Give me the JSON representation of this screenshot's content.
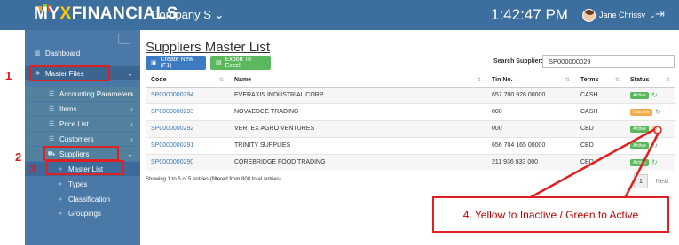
{
  "topbar": {
    "logo_prefix": "MY",
    "logo_x": "X",
    "logo_suffix": "FINANCIALS",
    "company": "Company S",
    "clock": "1:42:47 PM",
    "user": "Jane Chrissy"
  },
  "sidebar": {
    "items": [
      {
        "label": "Dashboard",
        "icon": "chart-icon"
      },
      {
        "label": "Master Files",
        "icon": "gear-icon"
      },
      {
        "label": "Accounting Parameters",
        "icon": "list-icon"
      },
      {
        "label": "Items",
        "icon": "list-icon"
      },
      {
        "label": "Price List",
        "icon": "list-icon"
      },
      {
        "label": "Customers",
        "icon": "list-icon"
      },
      {
        "label": "Suppliers",
        "icon": "truck-icon"
      },
      {
        "label": "Master List",
        "icon": "double-chevron-icon"
      },
      {
        "label": "Types",
        "icon": "double-chevron-icon"
      },
      {
        "label": "Classification",
        "icon": "double-chevron-icon"
      },
      {
        "label": "Groupings",
        "icon": "double-chevron-icon"
      }
    ]
  },
  "page": {
    "title": "Suppliers Master List",
    "create_button": "Create New (F1)",
    "export_button": "Export To Excel",
    "search_label": "Search Supplier:",
    "search_value": "SP000000029"
  },
  "table": {
    "headers": [
      "Code",
      "Name",
      "Tin No.",
      "Terms",
      "Status"
    ],
    "rows": [
      {
        "code": "SP0000000294",
        "name": "EVERAXIS INDUSTRIAL CORP.",
        "tin": "657 700 928 00000",
        "terms": "CASH",
        "status": "Active"
      },
      {
        "code": "SP0000000293",
        "name": "NOVAEDGE TRADING",
        "tin": "000",
        "terms": "CASH",
        "status": "Inactive"
      },
      {
        "code": "SP0000000292",
        "name": "VERTEX AGRO VENTURES",
        "tin": "000",
        "terms": "CBD",
        "status": "Active"
      },
      {
        "code": "SP0000000291",
        "name": "TRINITY SUPPLIES",
        "tin": "656 704 165 00000",
        "terms": "CBD",
        "status": "Active"
      },
      {
        "code": "SP0000000290",
        "name": "COREBRIDGE FOOD TRADING",
        "tin": "211 936 833 000",
        "terms": "CBD",
        "status": "Active"
      }
    ]
  },
  "footer": {
    "entries": "Showing 1 to 5 of 5 entries (filtered from 808 total entries)",
    "page": "1",
    "next": "Next"
  },
  "annotations": {
    "n1": "1",
    "n2": "2",
    "n3": "3",
    "callout": "4. Yellow to Inactive / Green to Active"
  },
  "colors": {
    "active": "#5cb85c",
    "inactive": "#f0ad4e",
    "annotation": "#e02020"
  }
}
